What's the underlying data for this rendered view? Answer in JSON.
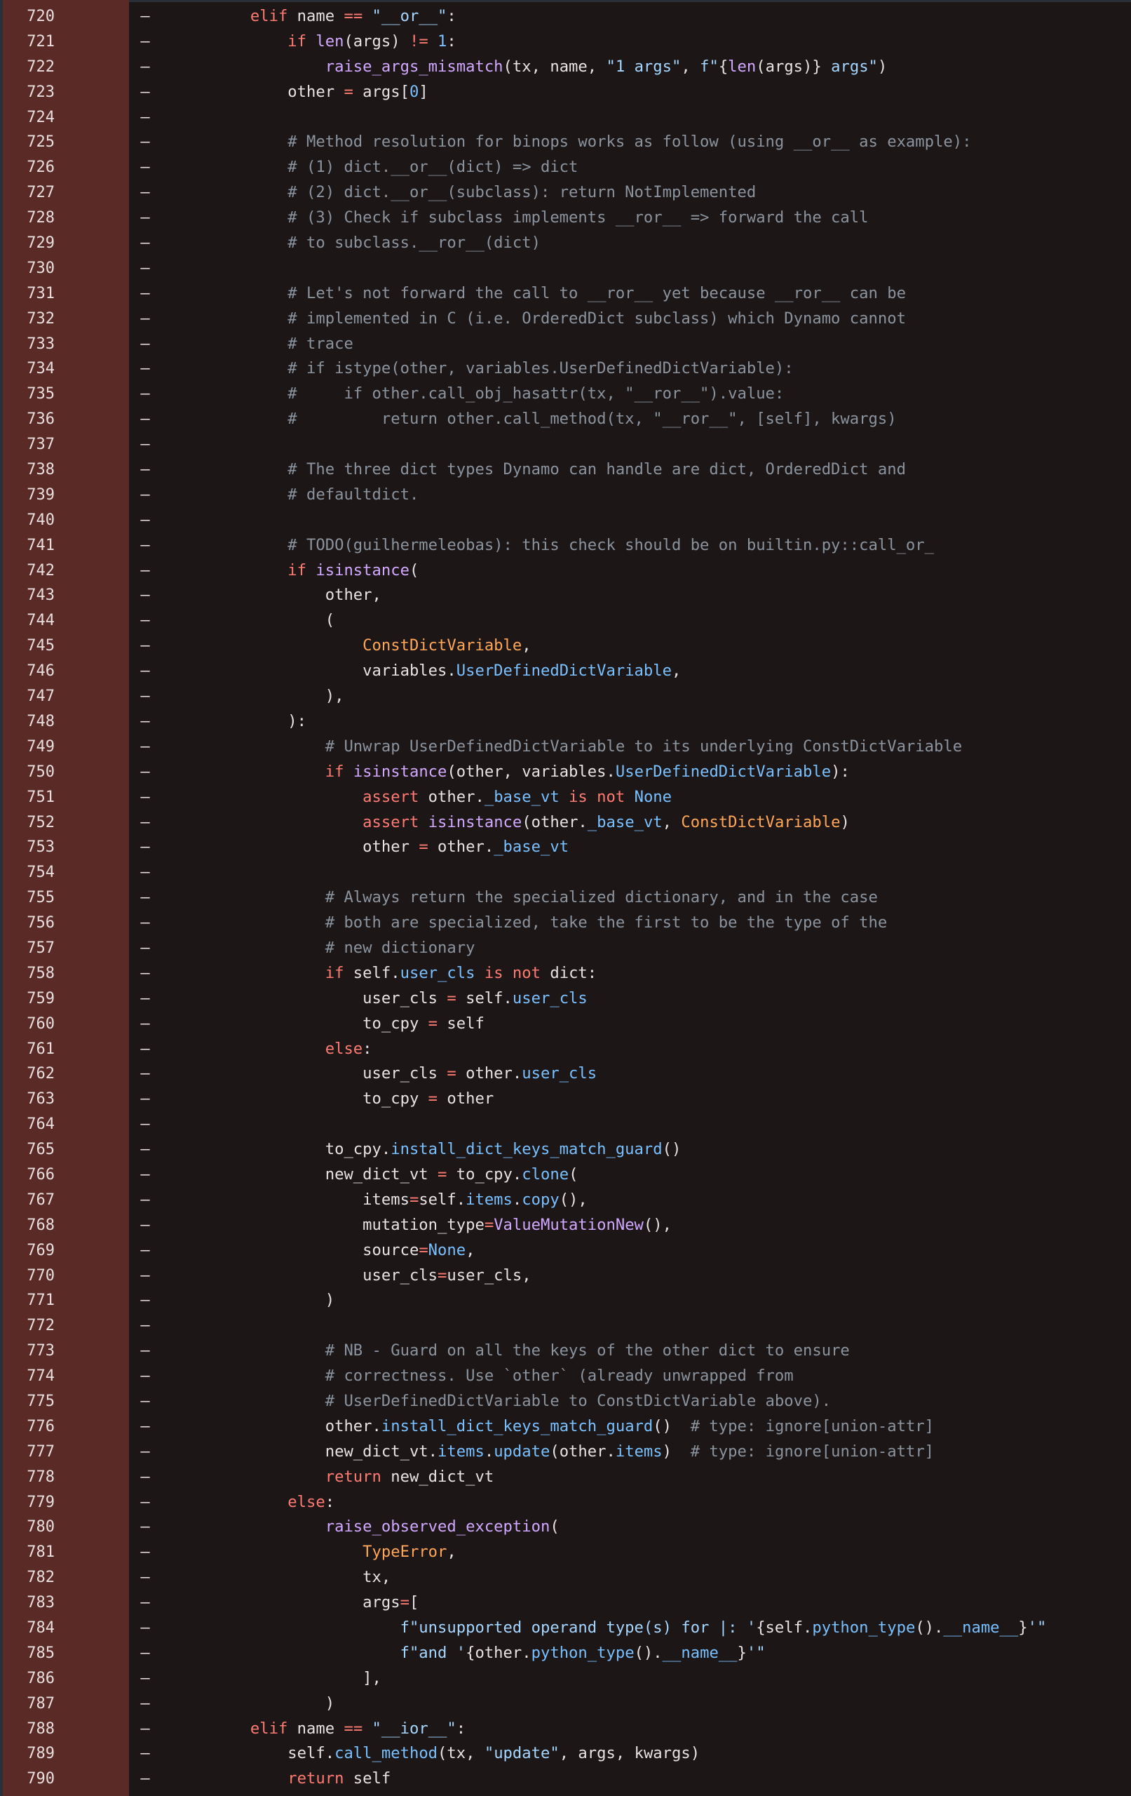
{
  "marker": "–",
  "colors": {
    "background": "#1c1617",
    "gutter": "#5a2a27",
    "text": "#e7e3e4",
    "keyword": "#ff7b72",
    "string": "#a5d6ff",
    "comment": "#8b949e",
    "function": "#d2a8ff",
    "attribute": "#79c0ff",
    "class": "#ffa657"
  },
  "lines": [
    {
      "num": "720",
      "tokens": [
        [
          "p",
          "        "
        ],
        [
          "k",
          "elif"
        ],
        [
          "p",
          " name "
        ],
        [
          "k",
          "=="
        ],
        [
          "p",
          " "
        ],
        [
          "s",
          "\"__or__\""
        ],
        [
          "p",
          ":"
        ]
      ]
    },
    {
      "num": "721",
      "tokens": [
        [
          "p",
          "            "
        ],
        [
          "k",
          "if"
        ],
        [
          "p",
          " "
        ],
        [
          "f",
          "len"
        ],
        [
          "p",
          "(args) "
        ],
        [
          "k",
          "!="
        ],
        [
          "p",
          " "
        ],
        [
          "a",
          "1"
        ],
        [
          "p",
          ":"
        ]
      ]
    },
    {
      "num": "722",
      "tokens": [
        [
          "p",
          "                "
        ],
        [
          "f",
          "raise_args_mismatch"
        ],
        [
          "p",
          "(tx, name, "
        ],
        [
          "s",
          "\"1 args\""
        ],
        [
          "p",
          ", "
        ],
        [
          "s",
          "f\""
        ],
        [
          "p",
          "{"
        ],
        [
          "f",
          "len"
        ],
        [
          "p",
          "(args)}"
        ],
        [
          "s",
          " args\""
        ],
        [
          "p",
          ")"
        ]
      ]
    },
    {
      "num": "723",
      "tokens": [
        [
          "p",
          "            other "
        ],
        [
          "k",
          "="
        ],
        [
          "p",
          " args["
        ],
        [
          "a",
          "0"
        ],
        [
          "p",
          "]"
        ]
      ]
    },
    {
      "num": "724",
      "tokens": []
    },
    {
      "num": "725",
      "tokens": [
        [
          "p",
          "            "
        ],
        [
          "c",
          "# Method resolution for binops works as follow (using __or__ as example):"
        ]
      ]
    },
    {
      "num": "726",
      "tokens": [
        [
          "p",
          "            "
        ],
        [
          "c",
          "# (1) dict.__or__(dict) => dict"
        ]
      ]
    },
    {
      "num": "727",
      "tokens": [
        [
          "p",
          "            "
        ],
        [
          "c",
          "# (2) dict.__or__(subclass): return NotImplemented"
        ]
      ]
    },
    {
      "num": "728",
      "tokens": [
        [
          "p",
          "            "
        ],
        [
          "c",
          "# (3) Check if subclass implements __ror__ => forward the call"
        ]
      ]
    },
    {
      "num": "729",
      "tokens": [
        [
          "p",
          "            "
        ],
        [
          "c",
          "# to subclass.__ror__(dict)"
        ]
      ]
    },
    {
      "num": "730",
      "tokens": []
    },
    {
      "num": "731",
      "tokens": [
        [
          "p",
          "            "
        ],
        [
          "c",
          "# Let's not forward the call to __ror__ yet because __ror__ can be"
        ]
      ]
    },
    {
      "num": "732",
      "tokens": [
        [
          "p",
          "            "
        ],
        [
          "c",
          "# implemented in C (i.e. OrderedDict subclass) which Dynamo cannot"
        ]
      ]
    },
    {
      "num": "733",
      "tokens": [
        [
          "p",
          "            "
        ],
        [
          "c",
          "# trace"
        ]
      ]
    },
    {
      "num": "734",
      "tokens": [
        [
          "p",
          "            "
        ],
        [
          "c",
          "# if istype(other, variables.UserDefinedDictVariable):"
        ]
      ]
    },
    {
      "num": "735",
      "tokens": [
        [
          "p",
          "            "
        ],
        [
          "c",
          "#     if other.call_obj_hasattr(tx, \"__ror__\").value:"
        ]
      ]
    },
    {
      "num": "736",
      "tokens": [
        [
          "p",
          "            "
        ],
        [
          "c",
          "#         return other.call_method(tx, \"__ror__\", [self], kwargs)"
        ]
      ]
    },
    {
      "num": "737",
      "tokens": []
    },
    {
      "num": "738",
      "tokens": [
        [
          "p",
          "            "
        ],
        [
          "c",
          "# The three dict types Dynamo can handle are dict, OrderedDict and"
        ]
      ]
    },
    {
      "num": "739",
      "tokens": [
        [
          "p",
          "            "
        ],
        [
          "c",
          "# defaultdict."
        ]
      ]
    },
    {
      "num": "740",
      "tokens": []
    },
    {
      "num": "741",
      "tokens": [
        [
          "p",
          "            "
        ],
        [
          "c",
          "# TODO(guilhermeleobas): this check should be on builtin.py::call_or_"
        ]
      ]
    },
    {
      "num": "742",
      "tokens": [
        [
          "p",
          "            "
        ],
        [
          "k",
          "if"
        ],
        [
          "p",
          " "
        ],
        [
          "f",
          "isinstance"
        ],
        [
          "p",
          "("
        ]
      ]
    },
    {
      "num": "743",
      "tokens": [
        [
          "p",
          "                other,"
        ]
      ]
    },
    {
      "num": "744",
      "tokens": [
        [
          "p",
          "                ("
        ]
      ]
    },
    {
      "num": "745",
      "tokens": [
        [
          "p",
          "                    "
        ],
        [
          "o",
          "ConstDictVariable"
        ],
        [
          "p",
          ","
        ]
      ]
    },
    {
      "num": "746",
      "tokens": [
        [
          "p",
          "                    variables."
        ],
        [
          "a",
          "UserDefinedDictVariable"
        ],
        [
          "p",
          ","
        ]
      ]
    },
    {
      "num": "747",
      "tokens": [
        [
          "p",
          "                ),"
        ]
      ]
    },
    {
      "num": "748",
      "tokens": [
        [
          "p",
          "            ):"
        ]
      ]
    },
    {
      "num": "749",
      "tokens": [
        [
          "p",
          "                "
        ],
        [
          "c",
          "# Unwrap UserDefinedDictVariable to its underlying ConstDictVariable"
        ]
      ]
    },
    {
      "num": "750",
      "tokens": [
        [
          "p",
          "                "
        ],
        [
          "k",
          "if"
        ],
        [
          "p",
          " "
        ],
        [
          "f",
          "isinstance"
        ],
        [
          "p",
          "(other, variables."
        ],
        [
          "a",
          "UserDefinedDictVariable"
        ],
        [
          "p",
          "):"
        ]
      ]
    },
    {
      "num": "751",
      "tokens": [
        [
          "p",
          "                    "
        ],
        [
          "k",
          "assert"
        ],
        [
          "p",
          " other."
        ],
        [
          "a",
          "_base_vt"
        ],
        [
          "p",
          " "
        ],
        [
          "k",
          "is not"
        ],
        [
          "p",
          " "
        ],
        [
          "a",
          "None"
        ]
      ]
    },
    {
      "num": "752",
      "tokens": [
        [
          "p",
          "                    "
        ],
        [
          "k",
          "assert"
        ],
        [
          "p",
          " "
        ],
        [
          "f",
          "isinstance"
        ],
        [
          "p",
          "(other."
        ],
        [
          "a",
          "_base_vt"
        ],
        [
          "p",
          ", "
        ],
        [
          "o",
          "ConstDictVariable"
        ],
        [
          "p",
          ")"
        ]
      ]
    },
    {
      "num": "753",
      "tokens": [
        [
          "p",
          "                    other "
        ],
        [
          "k",
          "="
        ],
        [
          "p",
          " other."
        ],
        [
          "a",
          "_base_vt"
        ]
      ]
    },
    {
      "num": "754",
      "tokens": []
    },
    {
      "num": "755",
      "tokens": [
        [
          "p",
          "                "
        ],
        [
          "c",
          "# Always return the specialized dictionary, and in the case"
        ]
      ]
    },
    {
      "num": "756",
      "tokens": [
        [
          "p",
          "                "
        ],
        [
          "c",
          "# both are specialized, take the first to be the type of the"
        ]
      ]
    },
    {
      "num": "757",
      "tokens": [
        [
          "p",
          "                "
        ],
        [
          "c",
          "# new dictionary"
        ]
      ]
    },
    {
      "num": "758",
      "tokens": [
        [
          "p",
          "                "
        ],
        [
          "k",
          "if"
        ],
        [
          "p",
          " self."
        ],
        [
          "a",
          "user_cls"
        ],
        [
          "p",
          " "
        ],
        [
          "k",
          "is not"
        ],
        [
          "p",
          " dict:"
        ]
      ]
    },
    {
      "num": "759",
      "tokens": [
        [
          "p",
          "                    user_cls "
        ],
        [
          "k",
          "="
        ],
        [
          "p",
          " self."
        ],
        [
          "a",
          "user_cls"
        ]
      ]
    },
    {
      "num": "760",
      "tokens": [
        [
          "p",
          "                    to_cpy "
        ],
        [
          "k",
          "="
        ],
        [
          "p",
          " self"
        ]
      ]
    },
    {
      "num": "761",
      "tokens": [
        [
          "p",
          "                "
        ],
        [
          "k",
          "else"
        ],
        [
          "p",
          ":"
        ]
      ]
    },
    {
      "num": "762",
      "tokens": [
        [
          "p",
          "                    user_cls "
        ],
        [
          "k",
          "="
        ],
        [
          "p",
          " other."
        ],
        [
          "a",
          "user_cls"
        ]
      ]
    },
    {
      "num": "763",
      "tokens": [
        [
          "p",
          "                    to_cpy "
        ],
        [
          "k",
          "="
        ],
        [
          "p",
          " other"
        ]
      ]
    },
    {
      "num": "764",
      "tokens": []
    },
    {
      "num": "765",
      "tokens": [
        [
          "p",
          "                to_cpy."
        ],
        [
          "a",
          "install_dict_keys_match_guard"
        ],
        [
          "p",
          "()"
        ]
      ]
    },
    {
      "num": "766",
      "tokens": [
        [
          "p",
          "                new_dict_vt "
        ],
        [
          "k",
          "="
        ],
        [
          "p",
          " to_cpy."
        ],
        [
          "a",
          "clone"
        ],
        [
          "p",
          "("
        ]
      ]
    },
    {
      "num": "767",
      "tokens": [
        [
          "p",
          "                    items"
        ],
        [
          "k",
          "="
        ],
        [
          "p",
          "self."
        ],
        [
          "a",
          "items"
        ],
        [
          "p",
          "."
        ],
        [
          "a",
          "copy"
        ],
        [
          "p",
          "(),"
        ]
      ]
    },
    {
      "num": "768",
      "tokens": [
        [
          "p",
          "                    mutation_type"
        ],
        [
          "k",
          "="
        ],
        [
          "f",
          "ValueMutationNew"
        ],
        [
          "p",
          "(),"
        ]
      ]
    },
    {
      "num": "769",
      "tokens": [
        [
          "p",
          "                    source"
        ],
        [
          "k",
          "="
        ],
        [
          "a",
          "None"
        ],
        [
          "p",
          ","
        ]
      ]
    },
    {
      "num": "770",
      "tokens": [
        [
          "p",
          "                    user_cls"
        ],
        [
          "k",
          "="
        ],
        [
          "p",
          "user_cls,"
        ]
      ]
    },
    {
      "num": "771",
      "tokens": [
        [
          "p",
          "                )"
        ]
      ]
    },
    {
      "num": "772",
      "tokens": []
    },
    {
      "num": "773",
      "tokens": [
        [
          "p",
          "                "
        ],
        [
          "c",
          "# NB - Guard on all the keys of the other dict to ensure"
        ]
      ]
    },
    {
      "num": "774",
      "tokens": [
        [
          "p",
          "                "
        ],
        [
          "c",
          "# correctness. Use `other` (already unwrapped from"
        ]
      ]
    },
    {
      "num": "775",
      "tokens": [
        [
          "p",
          "                "
        ],
        [
          "c",
          "# UserDefinedDictVariable to ConstDictVariable above)."
        ]
      ]
    },
    {
      "num": "776",
      "tokens": [
        [
          "p",
          "                other."
        ],
        [
          "a",
          "install_dict_keys_match_guard"
        ],
        [
          "p",
          "()  "
        ],
        [
          "c",
          "# type: ignore[union-attr]"
        ]
      ]
    },
    {
      "num": "777",
      "tokens": [
        [
          "p",
          "                new_dict_vt."
        ],
        [
          "a",
          "items"
        ],
        [
          "p",
          "."
        ],
        [
          "a",
          "update"
        ],
        [
          "p",
          "(other."
        ],
        [
          "a",
          "items"
        ],
        [
          "p",
          ")  "
        ],
        [
          "c",
          "# type: ignore[union-attr]"
        ]
      ]
    },
    {
      "num": "778",
      "tokens": [
        [
          "p",
          "                "
        ],
        [
          "k",
          "return"
        ],
        [
          "p",
          " new_dict_vt"
        ]
      ]
    },
    {
      "num": "779",
      "tokens": [
        [
          "p",
          "            "
        ],
        [
          "k",
          "else"
        ],
        [
          "p",
          ":"
        ]
      ]
    },
    {
      "num": "780",
      "tokens": [
        [
          "p",
          "                "
        ],
        [
          "f",
          "raise_observed_exception"
        ],
        [
          "p",
          "("
        ]
      ]
    },
    {
      "num": "781",
      "tokens": [
        [
          "p",
          "                    "
        ],
        [
          "o",
          "TypeError"
        ],
        [
          "p",
          ","
        ]
      ]
    },
    {
      "num": "782",
      "tokens": [
        [
          "p",
          "                    tx,"
        ]
      ]
    },
    {
      "num": "783",
      "tokens": [
        [
          "p",
          "                    args"
        ],
        [
          "k",
          "="
        ],
        [
          "p",
          "["
        ]
      ]
    },
    {
      "num": "784",
      "tokens": [
        [
          "p",
          "                        "
        ],
        [
          "s",
          "f\"unsupported operand type(s) for |: '"
        ],
        [
          "p",
          "{self."
        ],
        [
          "a",
          "python_type"
        ],
        [
          "p",
          "()."
        ],
        [
          "a",
          "__name__"
        ],
        [
          "p",
          "}"
        ],
        [
          "s",
          "'\""
        ]
      ]
    },
    {
      "num": "785",
      "tokens": [
        [
          "p",
          "                        "
        ],
        [
          "s",
          "f\"and '"
        ],
        [
          "p",
          "{other."
        ],
        [
          "a",
          "python_type"
        ],
        [
          "p",
          "()."
        ],
        [
          "a",
          "__name__"
        ],
        [
          "p",
          "}"
        ],
        [
          "s",
          "'\""
        ]
      ]
    },
    {
      "num": "786",
      "tokens": [
        [
          "p",
          "                    ],"
        ]
      ]
    },
    {
      "num": "787",
      "tokens": [
        [
          "p",
          "                )"
        ]
      ]
    },
    {
      "num": "788",
      "tokens": [
        [
          "p",
          "        "
        ],
        [
          "k",
          "elif"
        ],
        [
          "p",
          " name "
        ],
        [
          "k",
          "=="
        ],
        [
          "p",
          " "
        ],
        [
          "s",
          "\"__ior__\""
        ],
        [
          "p",
          ":"
        ]
      ]
    },
    {
      "num": "789",
      "tokens": [
        [
          "p",
          "            self."
        ],
        [
          "a",
          "call_method"
        ],
        [
          "p",
          "(tx, "
        ],
        [
          "s",
          "\"update\""
        ],
        [
          "p",
          ", args, kwargs)"
        ]
      ]
    },
    {
      "num": "790",
      "tokens": [
        [
          "p",
          "            "
        ],
        [
          "k",
          "return"
        ],
        [
          "p",
          " self"
        ]
      ]
    }
  ]
}
